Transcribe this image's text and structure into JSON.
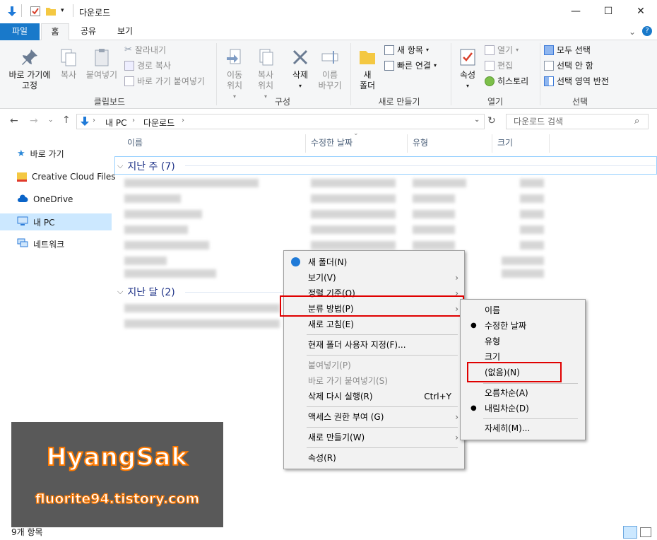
{
  "window": {
    "title": "다운로드",
    "minimize": "—",
    "maximize": "☐",
    "close": "✕",
    "help": "?"
  },
  "ribbon_tabs": [
    "파일",
    "홈",
    "공유",
    "보기"
  ],
  "ribbon": {
    "clipboard": {
      "pin": "바로 가기에\n고정",
      "copy": "복사",
      "paste": "붙여넣기",
      "cut": "잘라내기",
      "copy_path": "경로 복사",
      "paste_shortcut": "바로 가기 붙여넣기",
      "label": "클립보드"
    },
    "organize": {
      "move_to": "이동\n위치",
      "copy_to": "복사\n위치",
      "delete": "삭제",
      "rename": "이름\n바꾸기",
      "label": "구성"
    },
    "new": {
      "new_folder": "새\n폴더",
      "new_item": "새 항목",
      "easy_access": "빠른 연결",
      "label": "새로 만들기"
    },
    "open": {
      "properties": "속성",
      "open": "열기",
      "edit": "편집",
      "history": "히스토리",
      "label": "열기"
    },
    "select": {
      "select_all": "모두 선택",
      "select_none": "선택 안 함",
      "invert": "선택 영역 반전",
      "label": "선택"
    }
  },
  "address": {
    "path": [
      "내 PC",
      "다운로드"
    ],
    "search_placeholder": "다운로드 검색"
  },
  "nav_pane": [
    {
      "label": "바로 가기",
      "icon": "star-icon"
    },
    {
      "label": "Creative Cloud Files",
      "icon": "cc-folder-icon"
    },
    {
      "label": "OneDrive",
      "icon": "cloud-icon"
    },
    {
      "label": "내 PC",
      "icon": "computer-icon",
      "selected": true
    },
    {
      "label": "네트워크",
      "icon": "network-icon"
    }
  ],
  "columns": [
    "이름",
    "수정한 날짜",
    "유형",
    "크기"
  ],
  "groups": [
    {
      "label": "지난 주 (7)"
    },
    {
      "label": "지난 달 (2)"
    }
  ],
  "context_menu": {
    "items": [
      {
        "label": "새 폴더(N)",
        "icon": "new-folder-icon"
      },
      {
        "label": "보기(V)",
        "submenu": true
      },
      {
        "label": "정렬 기준(O)",
        "submenu": true
      },
      {
        "label": "분류 방법(P)",
        "submenu": true,
        "highlighted": true
      },
      {
        "label": "새로 고침(E)"
      },
      {
        "label": "현재 폴더 사용자 지정(F)..."
      },
      {
        "label": "붙여넣기(P)",
        "disabled": true
      },
      {
        "label": "바로 가기 붙여넣기(S)",
        "disabled": true
      },
      {
        "label": "삭제 다시 실행(R)",
        "shortcut": "Ctrl+Y"
      },
      {
        "label": "액세스 권한 부여 (G)",
        "submenu": true
      },
      {
        "label": "새로 만들기(W)",
        "submenu": true
      },
      {
        "label": "속성(R)"
      }
    ]
  },
  "group_by_submenu": {
    "items": [
      {
        "label": "이름"
      },
      {
        "label": "수정한 날짜",
        "checked": true
      },
      {
        "label": "유형"
      },
      {
        "label": "크기"
      },
      {
        "label": "(없음)(N)",
        "highlighted": true
      },
      {
        "label": "오름차순(A)"
      },
      {
        "label": "내림차순(D)",
        "checked": true
      },
      {
        "label": "자세히(M)..."
      }
    ]
  },
  "watermark": {
    "title": "HyangSak",
    "url": "fluorite94.tistory.com"
  },
  "status_bar": {
    "item_count": "9개 항목"
  },
  "colors": {
    "file_tab": "#1979ca",
    "selection": "#cce8ff",
    "highlight_box": "#e00000",
    "watermark_bg": "#595959",
    "watermark_stroke": "#ff7a00"
  }
}
